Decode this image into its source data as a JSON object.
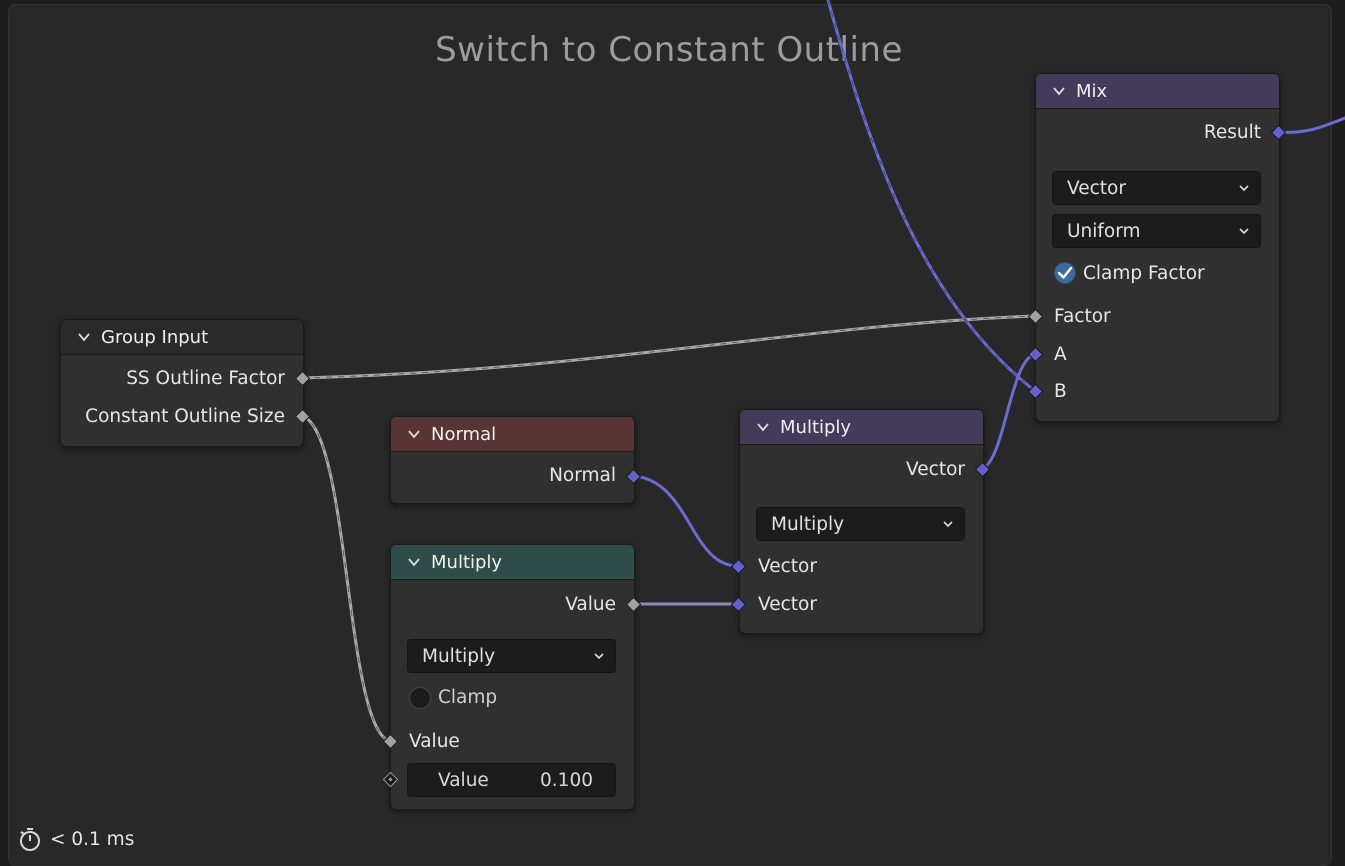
{
  "frame": {
    "title": "Switch to Constant Outline"
  },
  "colors": {
    "float_wire": "#a8a8a8",
    "vector_wire": "#6b6bd1",
    "mix_header": "#433b5a",
    "normal_header": "#583434",
    "math_header": "#2f4d48",
    "checkbox_checked": "#3d6b9a"
  },
  "nodes": {
    "group_input": {
      "title": "Group Input",
      "outputs": [
        "SS Outline Factor",
        "Constant Outline Size"
      ]
    },
    "normal": {
      "title": "Normal",
      "output": "Normal"
    },
    "math_multiply": {
      "title": "Multiply",
      "output": "Value",
      "operation": "Multiply",
      "clamp_label": "Clamp",
      "clamp_checked": false,
      "input_value_label": "Value",
      "field_label": "Value",
      "field_value": "0.100"
    },
    "vector_multiply": {
      "title": "Multiply",
      "output": "Vector",
      "operation": "Multiply",
      "inputs": [
        "Vector",
        "Vector"
      ]
    },
    "mix": {
      "title": "Mix",
      "output": "Result",
      "data_type": "Vector",
      "factor_mode": "Uniform",
      "clamp_factor_label": "Clamp Factor",
      "clamp_factor_checked": true,
      "inputs": [
        "Factor",
        "A",
        "B"
      ]
    }
  },
  "status": {
    "timing_icon": "stopwatch-icon",
    "timing": "< 0.1 ms"
  }
}
